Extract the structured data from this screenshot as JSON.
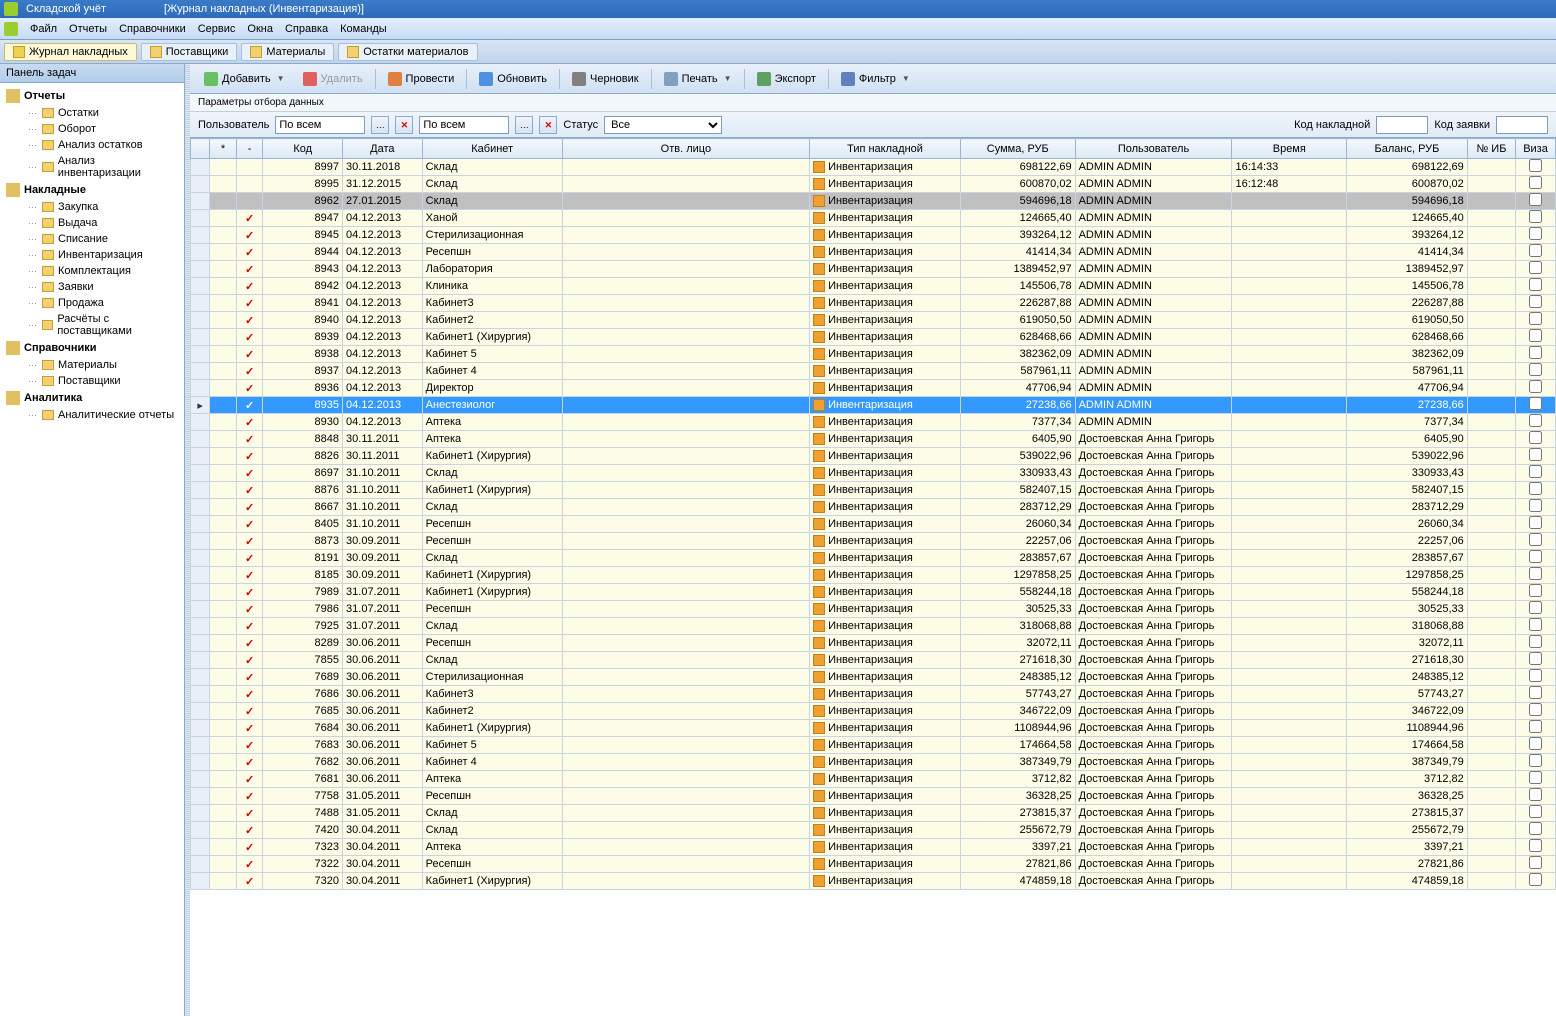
{
  "title": {
    "app": "Складской учёт",
    "doc": "[Журнал накладных (Инвентаризация)]"
  },
  "menu": [
    "Файл",
    "Отчеты",
    "Справочники",
    "Сервис",
    "Окна",
    "Справка",
    "Команды"
  ],
  "tabs": [
    {
      "label": "Журнал накладных",
      "active": true
    },
    {
      "label": "Поставщики",
      "active": false
    },
    {
      "label": "Материалы",
      "active": false
    },
    {
      "label": "Остатки материалов",
      "active": false
    }
  ],
  "sidebar": {
    "header": "Панель задач",
    "sections": [
      {
        "title": "Отчеты",
        "items": [
          "Остатки",
          "Оборот",
          "Анализ остатков",
          "Анализ инвентаризации"
        ]
      },
      {
        "title": "Накладные",
        "items": [
          "Закупка",
          "Выдача",
          "Списание",
          "Инвентаризация",
          "Комплектация",
          "Заявки",
          "Продажа",
          "Расчёты с поставщиками"
        ]
      },
      {
        "title": "Справочники",
        "items": [
          "Материалы",
          "Поставщики"
        ]
      },
      {
        "title": "Аналитика",
        "items": [
          "Аналитические отчеты"
        ]
      }
    ]
  },
  "toolbar": [
    {
      "label": "Добавить",
      "icon": "add",
      "dropdown": true
    },
    {
      "label": "Удалить",
      "icon": "del",
      "disabled": true
    },
    {
      "sep": true
    },
    {
      "label": "Провести",
      "icon": "check"
    },
    {
      "sep": true
    },
    {
      "label": "Обновить",
      "icon": "refresh"
    },
    {
      "sep": true
    },
    {
      "label": "Черновик",
      "icon": "draft"
    },
    {
      "sep": true
    },
    {
      "label": "Печать",
      "icon": "print",
      "dropdown": true
    },
    {
      "sep": true
    },
    {
      "label": "Экспорт",
      "icon": "export"
    },
    {
      "sep": true
    },
    {
      "label": "Фильтр",
      "icon": "filter",
      "dropdown": true
    }
  ],
  "params_label": "Параметры отбора данных",
  "filters": {
    "user_label": "Пользователь",
    "user_value": "По всем",
    "field2_value": "По всем",
    "status_label": "Статус",
    "status_value": "Все",
    "code_label": "Код накладной",
    "code_value": "",
    "request_label": "Код заявки",
    "request_value": ""
  },
  "columns": [
    "",
    "*",
    "-",
    "Код",
    "Дата",
    "Кабинет",
    "Отв. лицо",
    "Тип накладной",
    "Сумма, РУБ",
    "Пользователь",
    "Время",
    "Баланс, РУБ",
    "№ ИБ",
    "Виза"
  ],
  "rows": [
    {
      "c": "",
      "code": "8997",
      "date": "30.11.2018",
      "cab": "Склад",
      "resp": "",
      "type": "Инвентаризация",
      "sum": "698122,69",
      "user": "ADMIN ADMIN",
      "time": "16:14:33",
      "bal": "698122,69"
    },
    {
      "c": "",
      "code": "8995",
      "date": "31.12.2015",
      "cab": "Склад",
      "resp": "",
      "type": "Инвентаризация",
      "sum": "600870,02",
      "user": "ADMIN ADMIN",
      "time": "16:12:48",
      "bal": "600870,02"
    },
    {
      "c": "",
      "code": "8962",
      "date": "27.01.2015",
      "cab": "Склад",
      "resp": "",
      "type": "Инвентаризация",
      "sum": "594696,18",
      "user": "ADMIN ADMIN",
      "time": "",
      "bal": "594696,18",
      "sel": true
    },
    {
      "c": "✓",
      "code": "8947",
      "date": "04.12.2013",
      "cab": "Ханой",
      "resp": "",
      "type": "Инвентаризация",
      "sum": "124665,40",
      "user": "ADMIN ADMIN",
      "time": "",
      "bal": "124665,40"
    },
    {
      "c": "✓",
      "code": "8945",
      "date": "04.12.2013",
      "cab": "Стерилизационная",
      "resp": "",
      "type": "Инвентаризация",
      "sum": "393264,12",
      "user": "ADMIN ADMIN",
      "time": "",
      "bal": "393264,12"
    },
    {
      "c": "✓",
      "code": "8944",
      "date": "04.12.2013",
      "cab": "Ресепшн",
      "resp": "",
      "type": "Инвентаризация",
      "sum": "41414,34",
      "user": "ADMIN ADMIN",
      "time": "",
      "bal": "41414,34"
    },
    {
      "c": "✓",
      "code": "8943",
      "date": "04.12.2013",
      "cab": "Лаборатория",
      "resp": "",
      "type": "Инвентаризация",
      "sum": "1389452,97",
      "user": "ADMIN ADMIN",
      "time": "",
      "bal": "1389452,97"
    },
    {
      "c": "✓",
      "code": "8942",
      "date": "04.12.2013",
      "cab": "Клиника",
      "resp": "",
      "type": "Инвентаризация",
      "sum": "145506,78",
      "user": "ADMIN ADMIN",
      "time": "",
      "bal": "145506,78"
    },
    {
      "c": "✓",
      "code": "8941",
      "date": "04.12.2013",
      "cab": "Кабинет3",
      "resp": "",
      "type": "Инвентаризация",
      "sum": "226287,88",
      "user": "ADMIN ADMIN",
      "time": "",
      "bal": "226287,88"
    },
    {
      "c": "✓",
      "code": "8940",
      "date": "04.12.2013",
      "cab": "Кабинет2",
      "resp": "",
      "type": "Инвентаризация",
      "sum": "619050,50",
      "user": "ADMIN ADMIN",
      "time": "",
      "bal": "619050,50"
    },
    {
      "c": "✓",
      "code": "8939",
      "date": "04.12.2013",
      "cab": "Кабинет1 (Хирургия)",
      "resp": "",
      "type": "Инвентаризация",
      "sum": "628468,66",
      "user": "ADMIN ADMIN",
      "time": "",
      "bal": "628468,66"
    },
    {
      "c": "✓",
      "code": "8938",
      "date": "04.12.2013",
      "cab": "Кабинет 5",
      "resp": "",
      "type": "Инвентаризация",
      "sum": "382362,09",
      "user": "ADMIN ADMIN",
      "time": "",
      "bal": "382362,09"
    },
    {
      "c": "✓",
      "code": "8937",
      "date": "04.12.2013",
      "cab": "Кабинет 4",
      "resp": "",
      "type": "Инвентаризация",
      "sum": "587961,11",
      "user": "ADMIN ADMIN",
      "time": "",
      "bal": "587961,11"
    },
    {
      "c": "✓",
      "code": "8936",
      "date": "04.12.2013",
      "cab": "Директор",
      "resp": "",
      "type": "Инвентаризация",
      "sum": "47706,94",
      "user": "ADMIN ADMIN",
      "time": "",
      "bal": "47706,94"
    },
    {
      "c": "✓",
      "code": "8935",
      "date": "04.12.2013",
      "cab": "Анестезиолог",
      "resp": "",
      "type": "Инвентаризация",
      "sum": "27238,66",
      "user": "ADMIN ADMIN",
      "time": "",
      "bal": "27238,66",
      "hl": true
    },
    {
      "c": "✓",
      "code": "8930",
      "date": "04.12.2013",
      "cab": "Аптека",
      "resp": "",
      "type": "Инвентаризация",
      "sum": "7377,34",
      "user": "ADMIN ADMIN",
      "time": "",
      "bal": "7377,34"
    },
    {
      "c": "✓",
      "code": "8848",
      "date": "30.11.2011",
      "cab": "Аптека",
      "resp": "",
      "type": "Инвентаризация",
      "sum": "6405,90",
      "user": "Достоевская Анна Григорь",
      "time": "",
      "bal": "6405,90"
    },
    {
      "c": "✓",
      "code": "8826",
      "date": "30.11.2011",
      "cab": "Кабинет1 (Хирургия)",
      "resp": "",
      "type": "Инвентаризация",
      "sum": "539022,96",
      "user": "Достоевская Анна Григорь",
      "time": "",
      "bal": "539022,96"
    },
    {
      "c": "✓",
      "code": "8697",
      "date": "31.10.2011",
      "cab": "Склад",
      "resp": "",
      "type": "Инвентаризация",
      "sum": "330933,43",
      "user": "Достоевская Анна Григорь",
      "time": "",
      "bal": "330933,43"
    },
    {
      "c": "✓",
      "code": "8876",
      "date": "31.10.2011",
      "cab": "Кабинет1 (Хирургия)",
      "resp": "",
      "type": "Инвентаризация",
      "sum": "582407,15",
      "user": "Достоевская Анна Григорь",
      "time": "",
      "bal": "582407,15"
    },
    {
      "c": "✓",
      "code": "8667",
      "date": "31.10.2011",
      "cab": "Склад",
      "resp": "",
      "type": "Инвентаризация",
      "sum": "283712,29",
      "user": "Достоевская Анна Григорь",
      "time": "",
      "bal": "283712,29"
    },
    {
      "c": "✓",
      "code": "8405",
      "date": "31.10.2011",
      "cab": "Ресепшн",
      "resp": "",
      "type": "Инвентаризация",
      "sum": "26060,34",
      "user": "Достоевская Анна Григорь",
      "time": "",
      "bal": "26060,34"
    },
    {
      "c": "✓",
      "code": "8873",
      "date": "30.09.2011",
      "cab": "Ресепшн",
      "resp": "",
      "type": "Инвентаризация",
      "sum": "22257,06",
      "user": "Достоевская Анна Григорь",
      "time": "",
      "bal": "22257,06"
    },
    {
      "c": "✓",
      "code": "8191",
      "date": "30.09.2011",
      "cab": "Склад",
      "resp": "",
      "type": "Инвентаризация",
      "sum": "283857,67",
      "user": "Достоевская Анна Григорь",
      "time": "",
      "bal": "283857,67"
    },
    {
      "c": "✓",
      "code": "8185",
      "date": "30.09.2011",
      "cab": "Кабинет1 (Хирургия)",
      "resp": "",
      "type": "Инвентаризация",
      "sum": "1297858,25",
      "user": "Достоевская Анна Григорь",
      "time": "",
      "bal": "1297858,25"
    },
    {
      "c": "✓",
      "code": "7989",
      "date": "31.07.2011",
      "cab": "Кабинет1 (Хирургия)",
      "resp": "",
      "type": "Инвентаризация",
      "sum": "558244,18",
      "user": "Достоевская Анна Григорь",
      "time": "",
      "bal": "558244,18"
    },
    {
      "c": "✓",
      "code": "7986",
      "date": "31.07.2011",
      "cab": "Ресепшн",
      "resp": "",
      "type": "Инвентаризация",
      "sum": "30525,33",
      "user": "Достоевская Анна Григорь",
      "time": "",
      "bal": "30525,33"
    },
    {
      "c": "✓",
      "code": "7925",
      "date": "31.07.2011",
      "cab": "Склад",
      "resp": "",
      "type": "Инвентаризация",
      "sum": "318068,88",
      "user": "Достоевская Анна Григорь",
      "time": "",
      "bal": "318068,88"
    },
    {
      "c": "✓",
      "code": "8289",
      "date": "30.06.2011",
      "cab": "Ресепшн",
      "resp": "",
      "type": "Инвентаризация",
      "sum": "32072,11",
      "user": "Достоевская Анна Григорь",
      "time": "",
      "bal": "32072,11"
    },
    {
      "c": "✓",
      "code": "7855",
      "date": "30.06.2011",
      "cab": "Склад",
      "resp": "",
      "type": "Инвентаризация",
      "sum": "271618,30",
      "user": "Достоевская Анна Григорь",
      "time": "",
      "bal": "271618,30"
    },
    {
      "c": "✓",
      "code": "7689",
      "date": "30.06.2011",
      "cab": "Стерилизационная",
      "resp": "",
      "type": "Инвентаризация",
      "sum": "248385,12",
      "user": "Достоевская Анна Григорь",
      "time": "",
      "bal": "248385,12"
    },
    {
      "c": "✓",
      "code": "7686",
      "date": "30.06.2011",
      "cab": "Кабинет3",
      "resp": "",
      "type": "Инвентаризация",
      "sum": "57743,27",
      "user": "Достоевская Анна Григорь",
      "time": "",
      "bal": "57743,27"
    },
    {
      "c": "✓",
      "code": "7685",
      "date": "30.06.2011",
      "cab": "Кабинет2",
      "resp": "",
      "type": "Инвентаризация",
      "sum": "346722,09",
      "user": "Достоевская Анна Григорь",
      "time": "",
      "bal": "346722,09"
    },
    {
      "c": "✓",
      "code": "7684",
      "date": "30.06.2011",
      "cab": "Кабинет1 (Хирургия)",
      "resp": "",
      "type": "Инвентаризация",
      "sum": "1108944,96",
      "user": "Достоевская Анна Григорь",
      "time": "",
      "bal": "1108944,96"
    },
    {
      "c": "✓",
      "code": "7683",
      "date": "30.06.2011",
      "cab": "Кабинет 5",
      "resp": "",
      "type": "Инвентаризация",
      "sum": "174664,58",
      "user": "Достоевская Анна Григорь",
      "time": "",
      "bal": "174664,58"
    },
    {
      "c": "✓",
      "code": "7682",
      "date": "30.06.2011",
      "cab": "Кабинет 4",
      "resp": "",
      "type": "Инвентаризация",
      "sum": "387349,79",
      "user": "Достоевская Анна Григорь",
      "time": "",
      "bal": "387349,79"
    },
    {
      "c": "✓",
      "code": "7681",
      "date": "30.06.2011",
      "cab": "Аптека",
      "resp": "",
      "type": "Инвентаризация",
      "sum": "3712,82",
      "user": "Достоевская Анна Григорь",
      "time": "",
      "bal": "3712,82"
    },
    {
      "c": "✓",
      "code": "7758",
      "date": "31.05.2011",
      "cab": "Ресепшн",
      "resp": "",
      "type": "Инвентаризация",
      "sum": "36328,25",
      "user": "Достоевская Анна Григорь",
      "time": "",
      "bal": "36328,25"
    },
    {
      "c": "✓",
      "code": "7488",
      "date": "31.05.2011",
      "cab": "Склад",
      "resp": "",
      "type": "Инвентаризация",
      "sum": "273815,37",
      "user": "Достоевская Анна Григорь",
      "time": "",
      "bal": "273815,37"
    },
    {
      "c": "✓",
      "code": "7420",
      "date": "30.04.2011",
      "cab": "Склад",
      "resp": "",
      "type": "Инвентаризация",
      "sum": "255672,79",
      "user": "Достоевская Анна Григорь",
      "time": "",
      "bal": "255672,79"
    },
    {
      "c": "✓",
      "code": "7323",
      "date": "30.04.2011",
      "cab": "Аптека",
      "resp": "",
      "type": "Инвентаризация",
      "sum": "3397,21",
      "user": "Достоевская Анна Григорь",
      "time": "",
      "bal": "3397,21"
    },
    {
      "c": "✓",
      "code": "7322",
      "date": "30.04.2011",
      "cab": "Ресепшн",
      "resp": "",
      "type": "Инвентаризация",
      "sum": "27821,86",
      "user": "Достоевская Анна Григорь",
      "time": "",
      "bal": "27821,86"
    },
    {
      "c": "✓",
      "code": "7320",
      "date": "30.04.2011",
      "cab": "Кабинет1 (Хирургия)",
      "resp": "",
      "type": "Инвентаризация",
      "sum": "474859,18",
      "user": "Достоевская Анна Григорь",
      "time": "",
      "bal": "474859,18"
    }
  ]
}
